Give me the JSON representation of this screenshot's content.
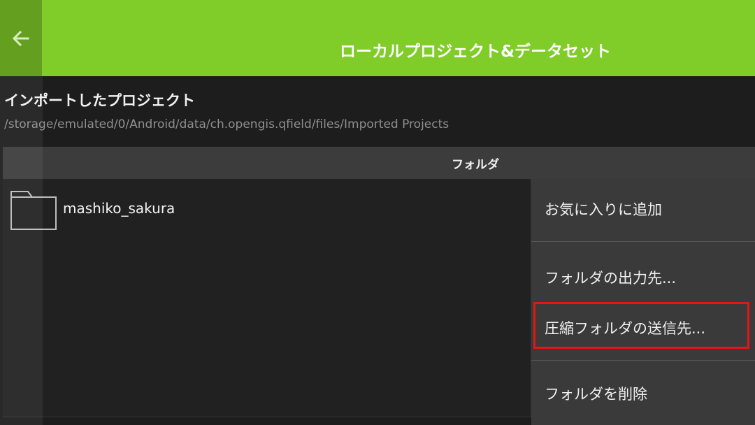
{
  "header": {
    "title": "ローカルプロジェクト&データセット",
    "back_icon": "arrow-left-icon",
    "background_color": "#80cc28"
  },
  "section": {
    "title": "インポートしたプロジェクト",
    "path": "/storage/emulated/0/Android/data/ch.opengis.qfield/files/Imported Projects"
  },
  "list": {
    "header_label": "フォルダ",
    "items": [
      {
        "icon": "folder-icon",
        "name": "mashiko_sakura"
      }
    ]
  },
  "context_menu": {
    "items": [
      {
        "label": "お気に入りに追加"
      },
      {
        "label": "フォルダの出力先..."
      },
      {
        "label": "圧縮フォルダの送信先...",
        "highlighted": true
      },
      {
        "label": "フォルダを削除"
      }
    ],
    "highlight_color": "#e31515"
  }
}
